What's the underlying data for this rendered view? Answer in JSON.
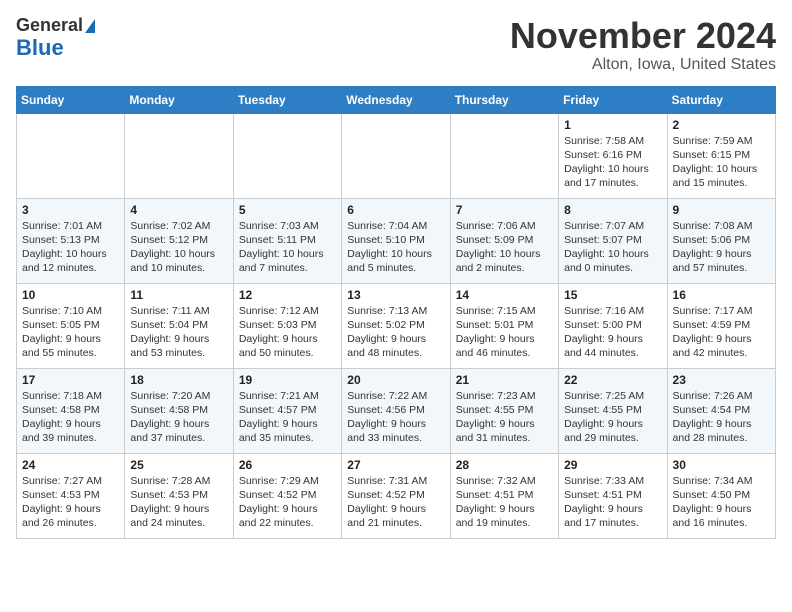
{
  "header": {
    "logo_line1": "General",
    "logo_line2": "Blue",
    "month_title": "November 2024",
    "location": "Alton, Iowa, United States"
  },
  "weekdays": [
    "Sunday",
    "Monday",
    "Tuesday",
    "Wednesday",
    "Thursday",
    "Friday",
    "Saturday"
  ],
  "weeks": [
    [
      {
        "day": "",
        "info": ""
      },
      {
        "day": "",
        "info": ""
      },
      {
        "day": "",
        "info": ""
      },
      {
        "day": "",
        "info": ""
      },
      {
        "day": "",
        "info": ""
      },
      {
        "day": "1",
        "info": "Sunrise: 7:58 AM\nSunset: 6:16 PM\nDaylight: 10 hours\nand 17 minutes."
      },
      {
        "day": "2",
        "info": "Sunrise: 7:59 AM\nSunset: 6:15 PM\nDaylight: 10 hours\nand 15 minutes."
      }
    ],
    [
      {
        "day": "3",
        "info": "Sunrise: 7:01 AM\nSunset: 5:13 PM\nDaylight: 10 hours\nand 12 minutes."
      },
      {
        "day": "4",
        "info": "Sunrise: 7:02 AM\nSunset: 5:12 PM\nDaylight: 10 hours\nand 10 minutes."
      },
      {
        "day": "5",
        "info": "Sunrise: 7:03 AM\nSunset: 5:11 PM\nDaylight: 10 hours\nand 7 minutes."
      },
      {
        "day": "6",
        "info": "Sunrise: 7:04 AM\nSunset: 5:10 PM\nDaylight: 10 hours\nand 5 minutes."
      },
      {
        "day": "7",
        "info": "Sunrise: 7:06 AM\nSunset: 5:09 PM\nDaylight: 10 hours\nand 2 minutes."
      },
      {
        "day": "8",
        "info": "Sunrise: 7:07 AM\nSunset: 5:07 PM\nDaylight: 10 hours\nand 0 minutes."
      },
      {
        "day": "9",
        "info": "Sunrise: 7:08 AM\nSunset: 5:06 PM\nDaylight: 9 hours\nand 57 minutes."
      }
    ],
    [
      {
        "day": "10",
        "info": "Sunrise: 7:10 AM\nSunset: 5:05 PM\nDaylight: 9 hours\nand 55 minutes."
      },
      {
        "day": "11",
        "info": "Sunrise: 7:11 AM\nSunset: 5:04 PM\nDaylight: 9 hours\nand 53 minutes."
      },
      {
        "day": "12",
        "info": "Sunrise: 7:12 AM\nSunset: 5:03 PM\nDaylight: 9 hours\nand 50 minutes."
      },
      {
        "day": "13",
        "info": "Sunrise: 7:13 AM\nSunset: 5:02 PM\nDaylight: 9 hours\nand 48 minutes."
      },
      {
        "day": "14",
        "info": "Sunrise: 7:15 AM\nSunset: 5:01 PM\nDaylight: 9 hours\nand 46 minutes."
      },
      {
        "day": "15",
        "info": "Sunrise: 7:16 AM\nSunset: 5:00 PM\nDaylight: 9 hours\nand 44 minutes."
      },
      {
        "day": "16",
        "info": "Sunrise: 7:17 AM\nSunset: 4:59 PM\nDaylight: 9 hours\nand 42 minutes."
      }
    ],
    [
      {
        "day": "17",
        "info": "Sunrise: 7:18 AM\nSunset: 4:58 PM\nDaylight: 9 hours\nand 39 minutes."
      },
      {
        "day": "18",
        "info": "Sunrise: 7:20 AM\nSunset: 4:58 PM\nDaylight: 9 hours\nand 37 minutes."
      },
      {
        "day": "19",
        "info": "Sunrise: 7:21 AM\nSunset: 4:57 PM\nDaylight: 9 hours\nand 35 minutes."
      },
      {
        "day": "20",
        "info": "Sunrise: 7:22 AM\nSunset: 4:56 PM\nDaylight: 9 hours\nand 33 minutes."
      },
      {
        "day": "21",
        "info": "Sunrise: 7:23 AM\nSunset: 4:55 PM\nDaylight: 9 hours\nand 31 minutes."
      },
      {
        "day": "22",
        "info": "Sunrise: 7:25 AM\nSunset: 4:55 PM\nDaylight: 9 hours\nand 29 minutes."
      },
      {
        "day": "23",
        "info": "Sunrise: 7:26 AM\nSunset: 4:54 PM\nDaylight: 9 hours\nand 28 minutes."
      }
    ],
    [
      {
        "day": "24",
        "info": "Sunrise: 7:27 AM\nSunset: 4:53 PM\nDaylight: 9 hours\nand 26 minutes."
      },
      {
        "day": "25",
        "info": "Sunrise: 7:28 AM\nSunset: 4:53 PM\nDaylight: 9 hours\nand 24 minutes."
      },
      {
        "day": "26",
        "info": "Sunrise: 7:29 AM\nSunset: 4:52 PM\nDaylight: 9 hours\nand 22 minutes."
      },
      {
        "day": "27",
        "info": "Sunrise: 7:31 AM\nSunset: 4:52 PM\nDaylight: 9 hours\nand 21 minutes."
      },
      {
        "day": "28",
        "info": "Sunrise: 7:32 AM\nSunset: 4:51 PM\nDaylight: 9 hours\nand 19 minutes."
      },
      {
        "day": "29",
        "info": "Sunrise: 7:33 AM\nSunset: 4:51 PM\nDaylight: 9 hours\nand 17 minutes."
      },
      {
        "day": "30",
        "info": "Sunrise: 7:34 AM\nSunset: 4:50 PM\nDaylight: 9 hours\nand 16 minutes."
      }
    ]
  ]
}
